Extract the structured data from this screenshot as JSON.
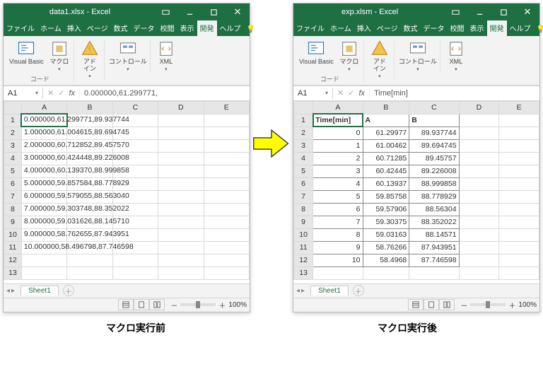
{
  "left": {
    "title": "data1.xlsx - Excel",
    "tabs": [
      "ファイル",
      "ホーム",
      "挿入",
      "ページ",
      "数式",
      "データ",
      "校閲",
      "表示",
      "開発",
      "ヘルプ",
      "操作"
    ],
    "activeTab": 8,
    "ribbon": {
      "btn_vb": "Visual Basic",
      "btn_macro": "マクロ",
      "grp_code": "コード",
      "btn_addin": "アド\nイン",
      "btn_control": "コントロール",
      "btn_xml": "XML"
    },
    "namebox": "A1",
    "fx": "0.000000,61.299771,",
    "cols": [
      "",
      "A",
      "B",
      "C",
      "D",
      "E"
    ],
    "rows": [
      "0.000000,61.299771,89.937744",
      "1.000000,61.004615,89.694745",
      "2.000000,60.712852,89.457570",
      "3.000000,60.424448,89.226008",
      "4.000000,60.139370,88.999858",
      "5.000000,59.857584,88.778929",
      "6.000000,59.579055,88.563040",
      "7.000000,59.303748,88.352022",
      "8.000000,59.031626,88.145710",
      "9.000000,58.762655,87.943951",
      "10.000000,58.496798,87.746598"
    ],
    "sheetTab": "Sheet1",
    "zoom": "100%",
    "caption": "マクロ実行前"
  },
  "right": {
    "title": "exp.xlsm - Excel",
    "tabs": [
      "ファイル",
      "ホーム",
      "挿入",
      "ページ",
      "数式",
      "データ",
      "校閲",
      "表示",
      "開発",
      "ヘルプ",
      "操作"
    ],
    "activeTab": 8,
    "ribbon": {
      "btn_vb": "Visual Basic",
      "btn_macro": "マクロ",
      "grp_code": "コード",
      "btn_addin": "アド\nイン",
      "btn_control": "コントロール",
      "btn_xml": "XML"
    },
    "namebox": "A1",
    "fx": "Time[min]",
    "cols": [
      "",
      "A",
      "B",
      "C",
      "D",
      "E"
    ],
    "headerRow": [
      "Time[min]",
      "A",
      "B"
    ],
    "rows": [
      [
        "0",
        "61.29977",
        "89.937744"
      ],
      [
        "1",
        "61.00462",
        "89.694745"
      ],
      [
        "2",
        "60.71285",
        "89.45757"
      ],
      [
        "3",
        "60.42445",
        "89.226008"
      ],
      [
        "4",
        "60.13937",
        "88.999858"
      ],
      [
        "5",
        "59.85758",
        "88.778929"
      ],
      [
        "6",
        "59.57906",
        "88.56304"
      ],
      [
        "7",
        "59.30375",
        "88.352022"
      ],
      [
        "8",
        "59.03163",
        "88.14571"
      ],
      [
        "9",
        "58.76266",
        "87.943951"
      ],
      [
        "10",
        "58.4968",
        "87.746598"
      ]
    ],
    "sheetTab": "Sheet1",
    "zoom": "100%",
    "caption": "マクロ実行後"
  },
  "icons": {
    "lightbulb": "◌"
  }
}
